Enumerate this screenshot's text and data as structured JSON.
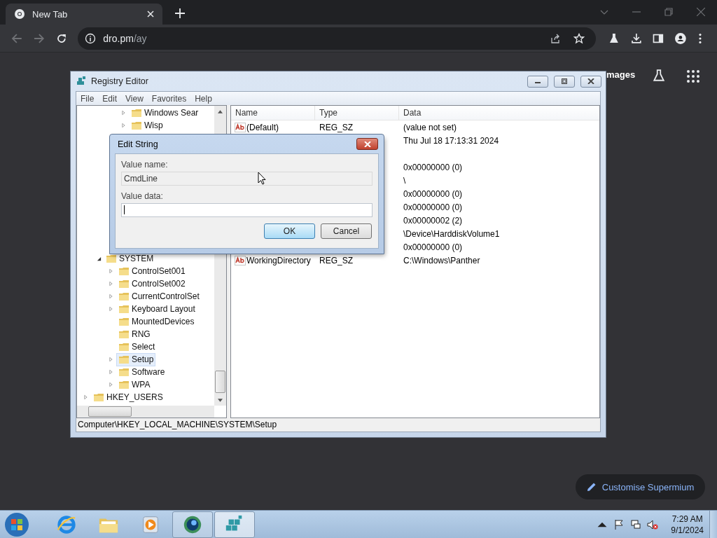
{
  "browser": {
    "tab": {
      "title": "New Tab"
    },
    "address": {
      "host": "dro.pm",
      "path": "/ay"
    }
  },
  "page": {
    "header_link": "mages",
    "customise_button": "Customise Supermium"
  },
  "registry_editor": {
    "title": "Registry Editor",
    "menu": [
      "File",
      "Edit",
      "View",
      "Favorites",
      "Help"
    ],
    "tree": {
      "upper_rows": [
        {
          "label": "Windows Sear",
          "has_children": true,
          "selected": false
        },
        {
          "label": "Wisp",
          "has_children": true,
          "selected": false
        }
      ],
      "system_node": {
        "label": "SYSTEM",
        "has_children": true,
        "expanded": true,
        "selected": false,
        "children": [
          {
            "label": "ControlSet001",
            "has_children": true,
            "selected": false
          },
          {
            "label": "ControlSet002",
            "has_children": true,
            "selected": false
          },
          {
            "label": "CurrentControlSet",
            "has_children": true,
            "selected": false
          },
          {
            "label": "Keyboard Layout",
            "has_children": true,
            "selected": false
          },
          {
            "label": "MountedDevices",
            "has_children": false,
            "selected": false
          },
          {
            "label": "RNG",
            "has_children": false,
            "selected": false
          },
          {
            "label": "Select",
            "has_children": false,
            "selected": false
          },
          {
            "label": "Setup",
            "has_children": true,
            "selected": true
          },
          {
            "label": "Software",
            "has_children": true,
            "selected": false
          },
          {
            "label": "WPA",
            "has_children": true,
            "selected": false
          }
        ]
      },
      "root_node": {
        "label": "HKEY_USERS",
        "has_children": true,
        "selected": false
      }
    },
    "columns": [
      "Name",
      "Type",
      "Data"
    ],
    "rows": [
      {
        "kind": "string",
        "name": "(Default)",
        "type": "REG_SZ",
        "data": "(value not set)"
      },
      {
        "data": "Thu Jul 18 17:13:31 2024"
      },
      {},
      {
        "data": "0x00000000 (0)"
      },
      {
        "data": "\\"
      },
      {
        "data": "0x00000000 (0)"
      },
      {
        "data": "0x00000000 (0)"
      },
      {
        "data": "0x00000002 (2)"
      },
      {
        "data": "\\Device\\HarddiskVolume1"
      },
      {
        "data": "0x00000000 (0)"
      },
      {
        "kind": "string",
        "name": "WorkingDirectory",
        "type": "REG_SZ",
        "data": "C:\\Windows\\Panther"
      }
    ],
    "status_bar": "Computer\\HKEY_LOCAL_MACHINE\\SYSTEM\\Setup"
  },
  "dialog": {
    "title": "Edit String",
    "value_name_label": "Value name:",
    "value_name": "CmdLine",
    "value_data_label": "Value data:",
    "buttons": [
      {
        "label": "OK",
        "default": true
      },
      {
        "label": "Cancel",
        "default": false
      }
    ]
  },
  "taskbar": {
    "apps": [
      {
        "kind": "ie",
        "running": false,
        "selected": false
      },
      {
        "kind": "explorer",
        "running": false,
        "selected": false
      },
      {
        "kind": "media",
        "running": false,
        "selected": false
      },
      {
        "kind": "globe",
        "running": true,
        "selected": false
      },
      {
        "kind": "regedit",
        "running": true,
        "selected": true
      }
    ],
    "time": "7:29 AM",
    "date": "9/1/2024"
  }
}
